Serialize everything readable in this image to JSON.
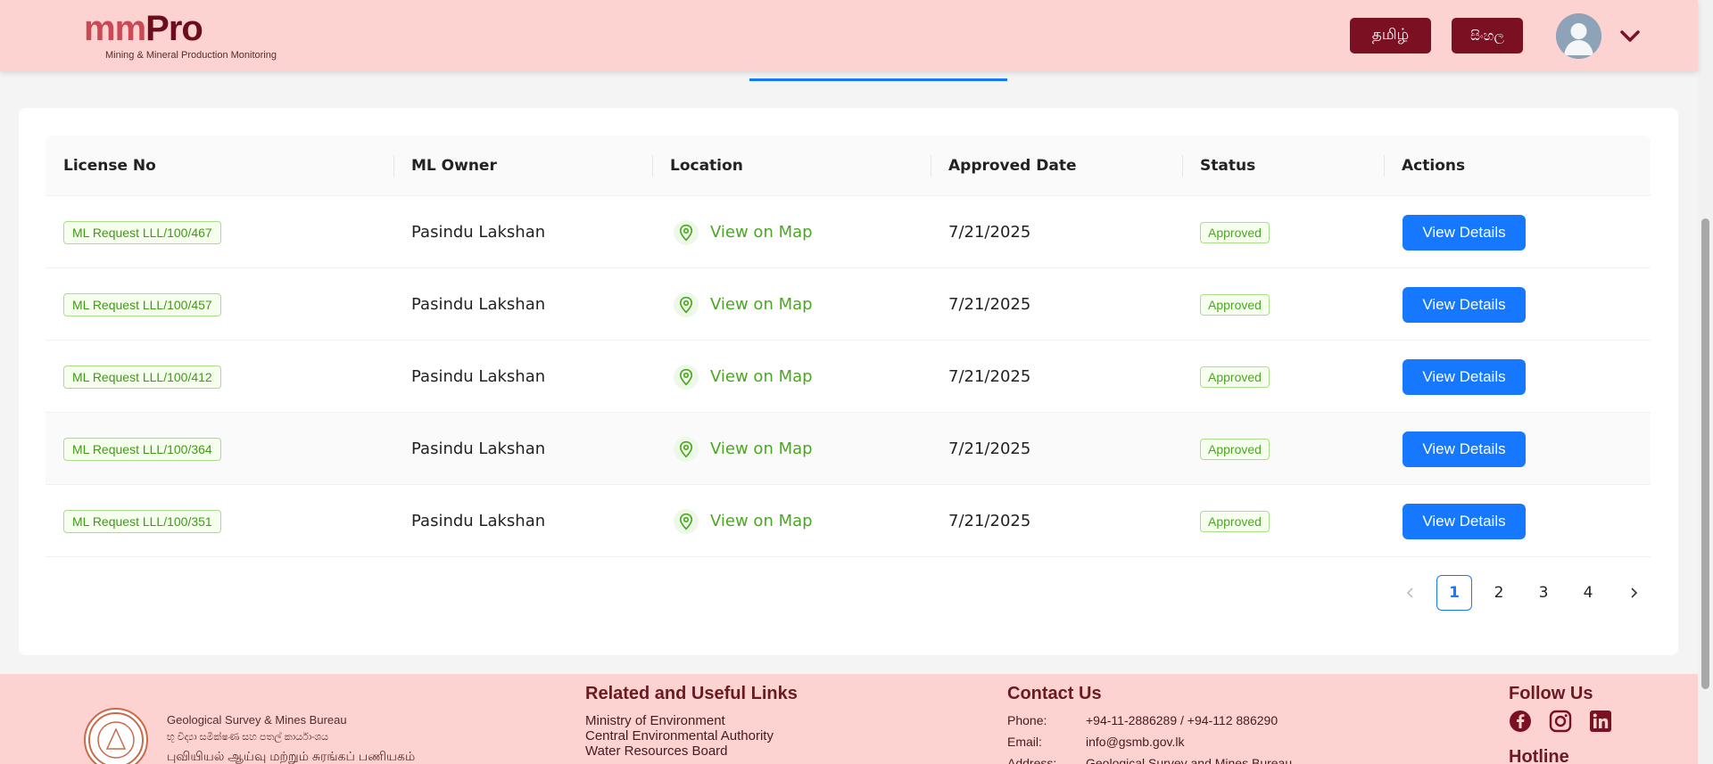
{
  "header": {
    "logo_mm": "mm",
    "logo_pro": "Pro",
    "logo_sub": "Mining & Mineral Production Monitoring",
    "lang_tamil": "தமிழ்",
    "lang_sinhala": "සිංහල"
  },
  "table": {
    "columns": [
      "License No",
      "ML Owner",
      "Location",
      "Approved Date",
      "Status",
      "Actions"
    ],
    "rows": [
      {
        "license": "ML Request LLL/100/467",
        "owner": "Pasindu Lakshan",
        "location": "View on Map",
        "date": "7/21/2025",
        "status": "Approved",
        "action": "View Details"
      },
      {
        "license": "ML Request LLL/100/457",
        "owner": "Pasindu Lakshan",
        "location": "View on Map",
        "date": "7/21/2025",
        "status": "Approved",
        "action": "View Details"
      },
      {
        "license": "ML Request LLL/100/412",
        "owner": "Pasindu Lakshan",
        "location": "View on Map",
        "date": "7/21/2025",
        "status": "Approved",
        "action": "View Details"
      },
      {
        "license": "ML Request LLL/100/364",
        "owner": "Pasindu Lakshan",
        "location": "View on Map",
        "date": "7/21/2025",
        "status": "Approved",
        "action": "View Details"
      },
      {
        "license": "ML Request LLL/100/351",
        "owner": "Pasindu Lakshan",
        "location": "View on Map",
        "date": "7/21/2025",
        "status": "Approved",
        "action": "View Details"
      }
    ]
  },
  "pagination": {
    "pages": [
      "1",
      "2",
      "3",
      "4"
    ],
    "current": "1"
  },
  "footer": {
    "org_en": "Geological Survey & Mines Bureau",
    "org_si": "භූ විද්‍යා සමීක්ෂණ සහ පතල් කාර්යාංශය",
    "org_ta": "புவியியல் ஆய்வு மற்றும் சுரங்கப் பணியகம்",
    "links_title": "Related and Useful Links",
    "links": [
      "Ministry of Environment",
      "Central Environmental Authority",
      "Water Resources Board"
    ],
    "contact_title": "Contact Us",
    "phone_label": "Phone:",
    "phone_value": "+94-11-2886289 / +94-112 886290",
    "email_label": "Email:",
    "email_value": "info@gsmb.gov.lk",
    "address_label": "Address:",
    "address_value": "Geological Survey and Mines Bureau",
    "follow_title": "Follow Us",
    "hotline_title": "Hotline"
  },
  "colors": {
    "header_bg": "#fcd3d1",
    "brand_dark": "#7a1022",
    "primary": "#1677ff",
    "success": "#4aa820"
  },
  "icons": {
    "avatar": "user-avatar-icon",
    "chevron": "chevron-down-icon",
    "pin": "map-pin-icon",
    "facebook": "facebook-icon",
    "instagram": "instagram-icon",
    "linkedin": "linkedin-icon"
  }
}
